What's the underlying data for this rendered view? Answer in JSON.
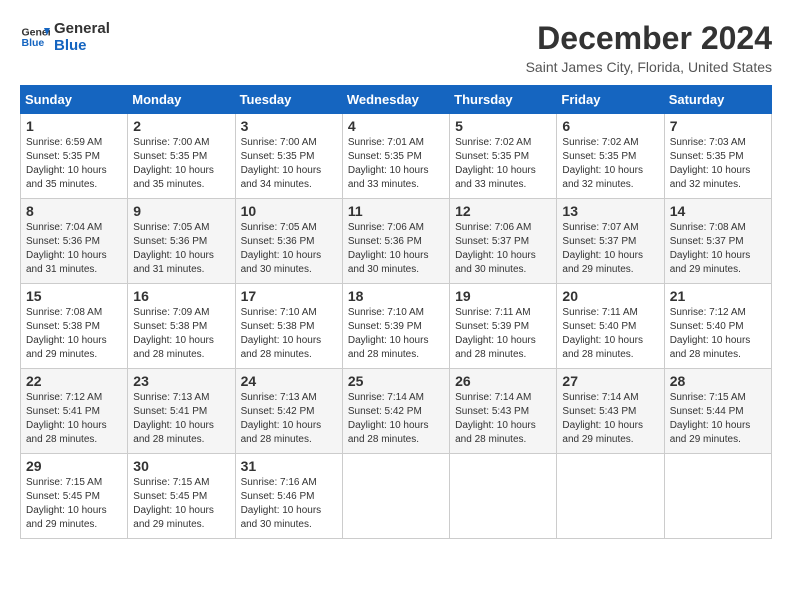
{
  "header": {
    "logo_line1": "General",
    "logo_line2": "Blue",
    "title": "December 2024",
    "subtitle": "Saint James City, Florida, United States"
  },
  "weekdays": [
    "Sunday",
    "Monday",
    "Tuesday",
    "Wednesday",
    "Thursday",
    "Friday",
    "Saturday"
  ],
  "weeks": [
    [
      {
        "day": "1",
        "info": "Sunrise: 6:59 AM\nSunset: 5:35 PM\nDaylight: 10 hours\nand 35 minutes."
      },
      {
        "day": "2",
        "info": "Sunrise: 7:00 AM\nSunset: 5:35 PM\nDaylight: 10 hours\nand 35 minutes."
      },
      {
        "day": "3",
        "info": "Sunrise: 7:00 AM\nSunset: 5:35 PM\nDaylight: 10 hours\nand 34 minutes."
      },
      {
        "day": "4",
        "info": "Sunrise: 7:01 AM\nSunset: 5:35 PM\nDaylight: 10 hours\nand 33 minutes."
      },
      {
        "day": "5",
        "info": "Sunrise: 7:02 AM\nSunset: 5:35 PM\nDaylight: 10 hours\nand 33 minutes."
      },
      {
        "day": "6",
        "info": "Sunrise: 7:02 AM\nSunset: 5:35 PM\nDaylight: 10 hours\nand 32 minutes."
      },
      {
        "day": "7",
        "info": "Sunrise: 7:03 AM\nSunset: 5:35 PM\nDaylight: 10 hours\nand 32 minutes."
      }
    ],
    [
      {
        "day": "8",
        "info": "Sunrise: 7:04 AM\nSunset: 5:36 PM\nDaylight: 10 hours\nand 31 minutes."
      },
      {
        "day": "9",
        "info": "Sunrise: 7:05 AM\nSunset: 5:36 PM\nDaylight: 10 hours\nand 31 minutes."
      },
      {
        "day": "10",
        "info": "Sunrise: 7:05 AM\nSunset: 5:36 PM\nDaylight: 10 hours\nand 30 minutes."
      },
      {
        "day": "11",
        "info": "Sunrise: 7:06 AM\nSunset: 5:36 PM\nDaylight: 10 hours\nand 30 minutes."
      },
      {
        "day": "12",
        "info": "Sunrise: 7:06 AM\nSunset: 5:37 PM\nDaylight: 10 hours\nand 30 minutes."
      },
      {
        "day": "13",
        "info": "Sunrise: 7:07 AM\nSunset: 5:37 PM\nDaylight: 10 hours\nand 29 minutes."
      },
      {
        "day": "14",
        "info": "Sunrise: 7:08 AM\nSunset: 5:37 PM\nDaylight: 10 hours\nand 29 minutes."
      }
    ],
    [
      {
        "day": "15",
        "info": "Sunrise: 7:08 AM\nSunset: 5:38 PM\nDaylight: 10 hours\nand 29 minutes."
      },
      {
        "day": "16",
        "info": "Sunrise: 7:09 AM\nSunset: 5:38 PM\nDaylight: 10 hours\nand 28 minutes."
      },
      {
        "day": "17",
        "info": "Sunrise: 7:10 AM\nSunset: 5:38 PM\nDaylight: 10 hours\nand 28 minutes."
      },
      {
        "day": "18",
        "info": "Sunrise: 7:10 AM\nSunset: 5:39 PM\nDaylight: 10 hours\nand 28 minutes."
      },
      {
        "day": "19",
        "info": "Sunrise: 7:11 AM\nSunset: 5:39 PM\nDaylight: 10 hours\nand 28 minutes."
      },
      {
        "day": "20",
        "info": "Sunrise: 7:11 AM\nSunset: 5:40 PM\nDaylight: 10 hours\nand 28 minutes."
      },
      {
        "day": "21",
        "info": "Sunrise: 7:12 AM\nSunset: 5:40 PM\nDaylight: 10 hours\nand 28 minutes."
      }
    ],
    [
      {
        "day": "22",
        "info": "Sunrise: 7:12 AM\nSunset: 5:41 PM\nDaylight: 10 hours\nand 28 minutes."
      },
      {
        "day": "23",
        "info": "Sunrise: 7:13 AM\nSunset: 5:41 PM\nDaylight: 10 hours\nand 28 minutes."
      },
      {
        "day": "24",
        "info": "Sunrise: 7:13 AM\nSunset: 5:42 PM\nDaylight: 10 hours\nand 28 minutes."
      },
      {
        "day": "25",
        "info": "Sunrise: 7:14 AM\nSunset: 5:42 PM\nDaylight: 10 hours\nand 28 minutes."
      },
      {
        "day": "26",
        "info": "Sunrise: 7:14 AM\nSunset: 5:43 PM\nDaylight: 10 hours\nand 28 minutes."
      },
      {
        "day": "27",
        "info": "Sunrise: 7:14 AM\nSunset: 5:43 PM\nDaylight: 10 hours\nand 29 minutes."
      },
      {
        "day": "28",
        "info": "Sunrise: 7:15 AM\nSunset: 5:44 PM\nDaylight: 10 hours\nand 29 minutes."
      }
    ],
    [
      {
        "day": "29",
        "info": "Sunrise: 7:15 AM\nSunset: 5:45 PM\nDaylight: 10 hours\nand 29 minutes."
      },
      {
        "day": "30",
        "info": "Sunrise: 7:15 AM\nSunset: 5:45 PM\nDaylight: 10 hours\nand 29 minutes."
      },
      {
        "day": "31",
        "info": "Sunrise: 7:16 AM\nSunset: 5:46 PM\nDaylight: 10 hours\nand 30 minutes."
      },
      null,
      null,
      null,
      null
    ]
  ]
}
